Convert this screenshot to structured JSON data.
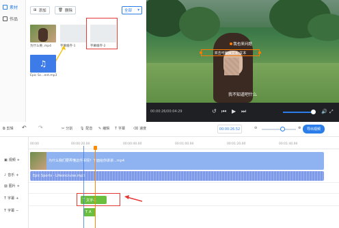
{
  "sidebar": {
    "items": [
      {
        "label": "素材"
      },
      {
        "label": "作品"
      }
    ]
  },
  "media": {
    "add_label": "添加",
    "delete_label": "删除",
    "filter_label": "全部",
    "items": [
      {
        "caption": "为什么要..mp4"
      },
      {
        "caption": "字幕缓存-1"
      },
      {
        "caption": "字幕缓存-2"
      },
      {
        "caption": "Epic Sc...ent.mp3"
      }
    ]
  },
  "preview": {
    "overlay_top": "我也来问题",
    "overlay_box": "双击可编辑文本-文本",
    "subtitle": "我不知道吧什么",
    "time": "00:00:26/00:04:29"
  },
  "toolbar": {
    "left_label": "剪辑",
    "split": "分割",
    "voice": "配音",
    "edit": "编辑",
    "subtitle": "字幕",
    "speed": "速度",
    "time_value": "00:00:26.52",
    "export": "导出视频"
  },
  "timeline": {
    "tracks": [
      {
        "label": "视频"
      },
      {
        "label": "音乐"
      },
      {
        "label": "图片"
      },
      {
        "label": "字幕"
      },
      {
        "label": "字幕"
      }
    ],
    "ticks": [
      "00:00",
      "00:00:20.00",
      "00:00:40.00",
      "00:01:00.00",
      "00:01:20.00",
      "00:01:40.00"
    ],
    "video_clip": "为什么我们要弄懂这件事情？下面给你讲讲...mp4",
    "audio_clip": "Epic Sports - Lifeoncruise.mp3",
    "text_clip_1": "文字-1",
    "text_clip_2": "A"
  }
}
